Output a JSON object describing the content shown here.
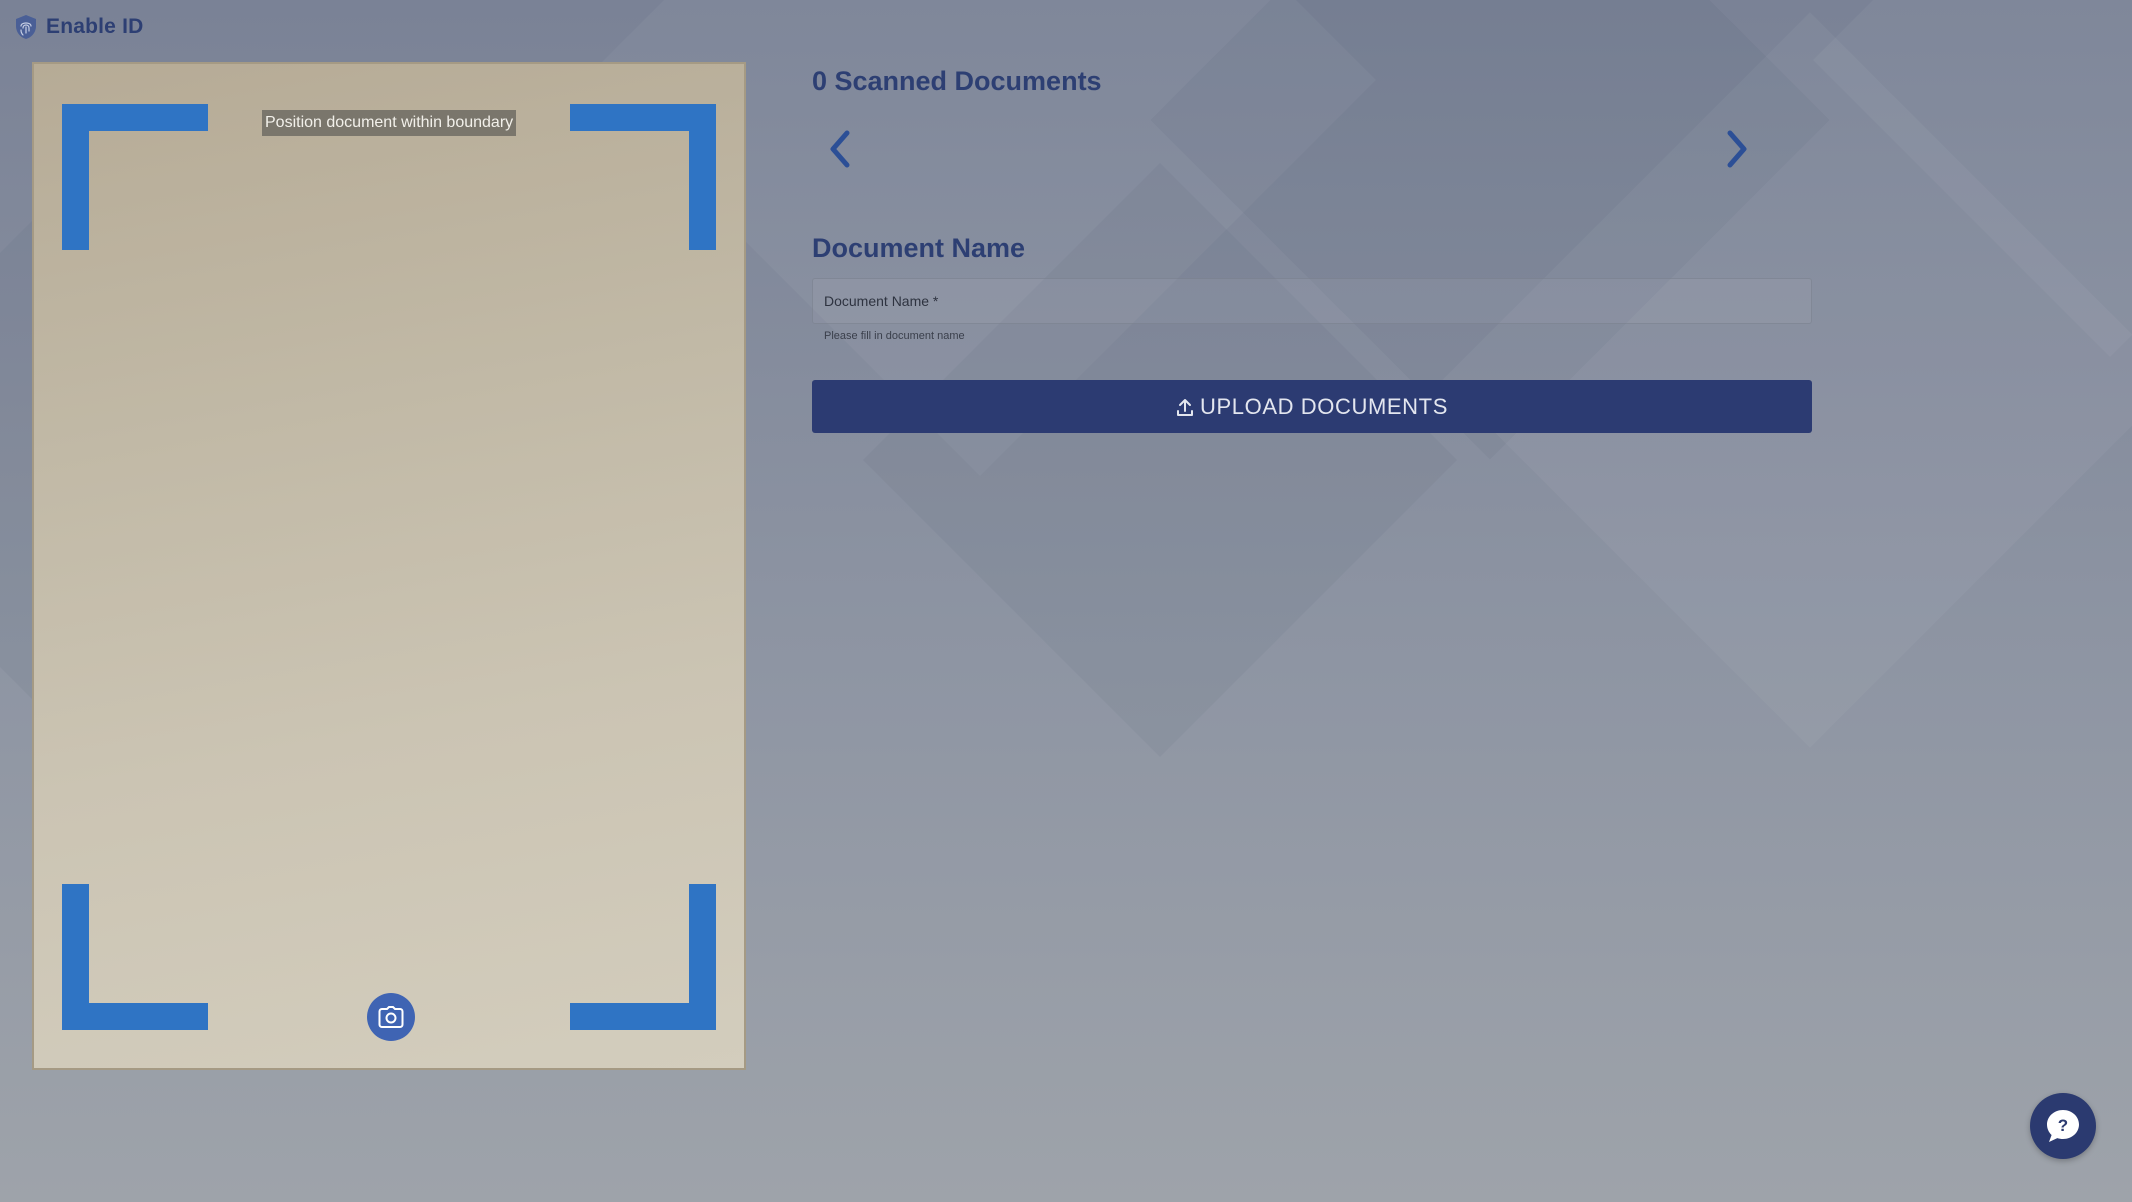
{
  "app": {
    "title": "Enable ID",
    "logo_icon": "fingerprint-shield-icon"
  },
  "camera": {
    "hint": "Position document within boundary",
    "capture_icon": "camera-icon"
  },
  "documents": {
    "scanned_title": "0 Scanned Documents",
    "prev_icon": "chevron-left-icon",
    "next_icon": "chevron-right-icon"
  },
  "form": {
    "heading": "Document Name",
    "field_label": "Document Name *",
    "field_value": "",
    "helper": "Please fill in document name",
    "upload_label": "UPLOAD DOCUMENTS",
    "upload_icon": "upload-icon"
  },
  "help": {
    "icon": "help-chat-icon",
    "symbol": "?"
  },
  "colors": {
    "primary": "#2c3b72",
    "heading": "#2d3f73",
    "frame": "#2f74c4",
    "capture": "#3f64b3"
  }
}
